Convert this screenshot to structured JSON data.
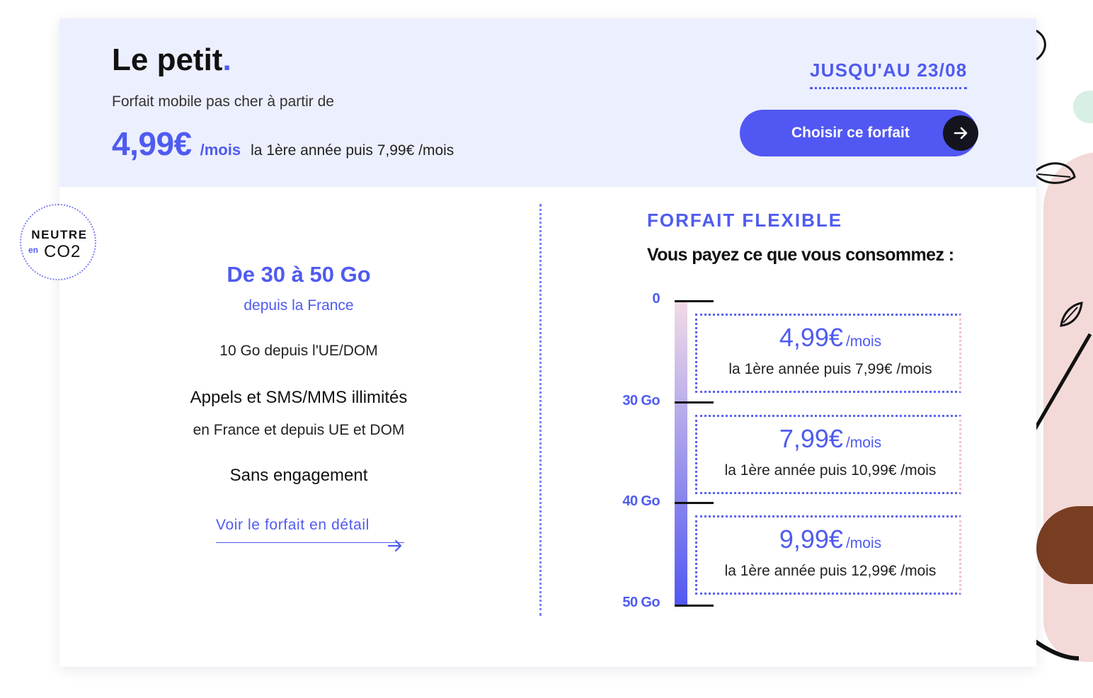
{
  "plan": {
    "title": "Le petit",
    "title_dot": ".",
    "subtitle": "Forfait mobile pas cher à partir de",
    "price": "4,99€",
    "price_unit": "/mois",
    "price_after": "la 1ère année puis 7,99€ /mois",
    "promo_until": "JUSQU'AU 23/08",
    "choose_label": "Choisir ce forfait"
  },
  "badge": {
    "line1": "NEUTRE",
    "en": "en",
    "co2": "CO2"
  },
  "features": {
    "data_volume": "De 30 à 50 Go",
    "data_from": "depuis la France",
    "data_eu": "10 Go depuis l'UE/DOM",
    "calls": "Appels et SMS/MMS illimités",
    "calls_sub": "en France et depuis UE et DOM",
    "commitment": "Sans engagement",
    "detail_link": "Voir le forfait en détail"
  },
  "flexible": {
    "title": "FORFAIT FLEXIBLE",
    "subtitle": "Vous payez ce que vous consommez :",
    "scale": [
      "0",
      "30 Go",
      "40 Go",
      "50 Go"
    ],
    "tiers": [
      {
        "price": "4,99€",
        "unit": "/mois",
        "after": "la 1ère année puis 7,99€ /mois"
      },
      {
        "price": "7,99€",
        "unit": "/mois",
        "after": "la 1ère année puis 10,99€ /mois"
      },
      {
        "price": "9,99€",
        "unit": "/mois",
        "after": "la 1ère année puis 12,99€ /mois"
      }
    ]
  },
  "colors": {
    "accent": "#4f5bf0",
    "button": "#5157f2",
    "header_bg": "#eceffd",
    "dark": "#14141e"
  },
  "icons": [
    "arrow-right-icon",
    "leaf-icon"
  ]
}
